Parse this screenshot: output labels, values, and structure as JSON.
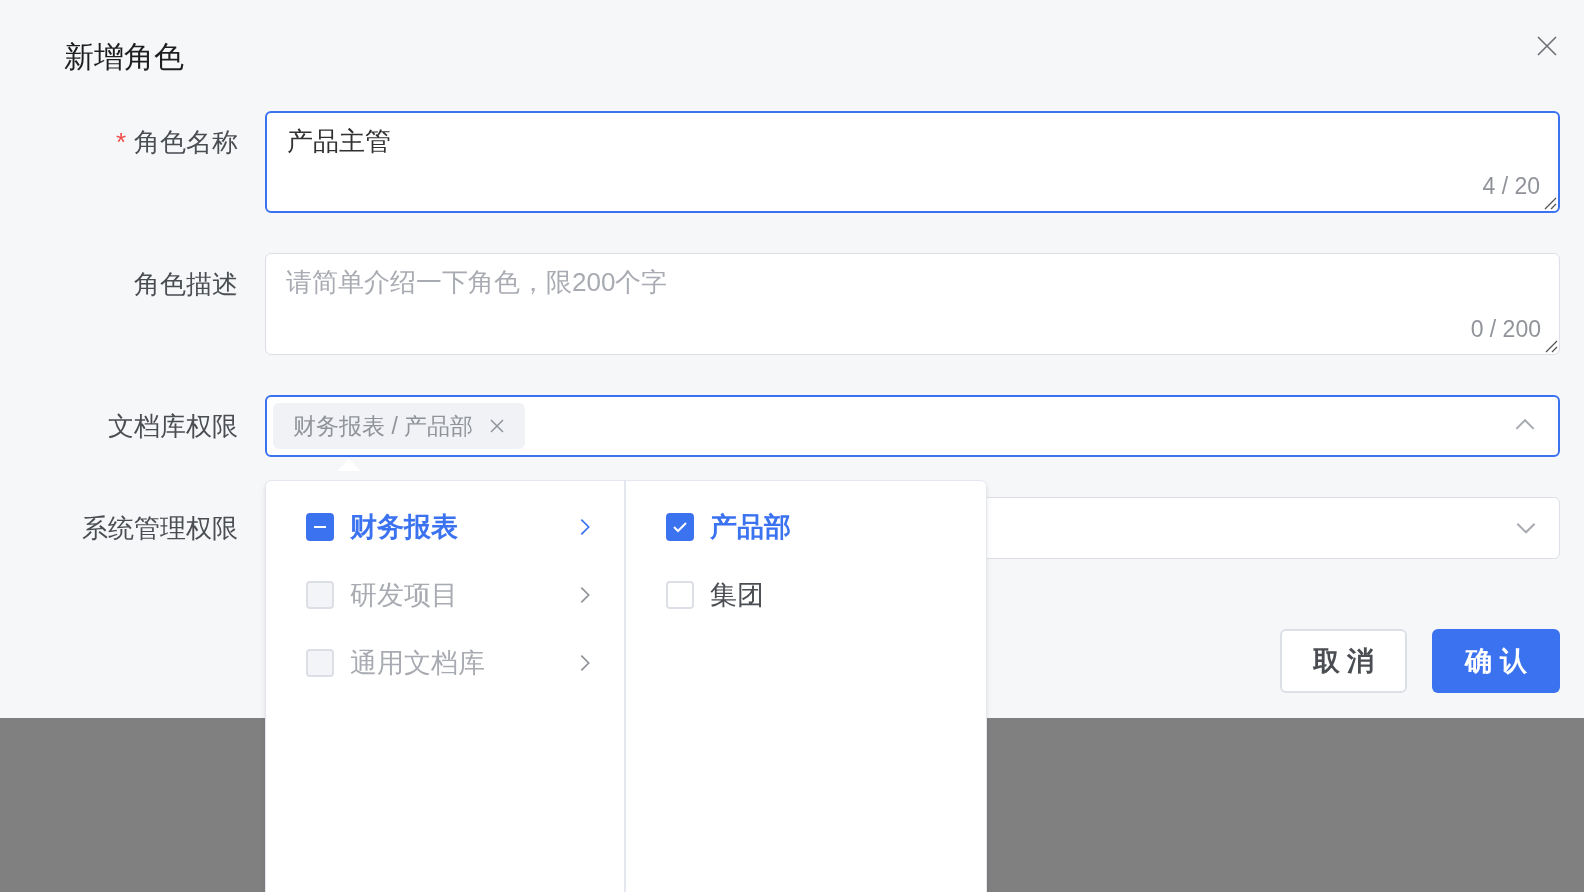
{
  "dialog": {
    "title": "新增角色",
    "fields": [
      {
        "kind": "textarea",
        "label": "角色名称",
        "required_mark": "*",
        "value": "产品主管",
        "counter": "4 / 20",
        "focused": true
      },
      {
        "kind": "textarea",
        "label": "角色描述",
        "placeholder": "请简单介绍一下角色，限200个字",
        "counter": "0 / 200",
        "focused": false
      },
      {
        "kind": "select",
        "label": "文档库权限",
        "tags": [
          "财务报表 / 产品部"
        ],
        "expanded": true,
        "focused": true
      },
      {
        "kind": "select",
        "label": "系统管理权限",
        "expanded": false,
        "focused": false
      }
    ],
    "buttons": [
      {
        "kind": "default",
        "label": "取 消"
      },
      {
        "kind": "primary",
        "label": "确 认"
      }
    ]
  },
  "cascader": {
    "columns": [
      [
        {
          "label": "财务报表",
          "checked": false,
          "indeterminate": true,
          "disabled": false,
          "selected": true,
          "has_children": true
        },
        {
          "label": "研发项目",
          "checked": false,
          "indeterminate": false,
          "disabled": true,
          "selected": false,
          "has_children": true
        },
        {
          "label": "通用文档库",
          "checked": false,
          "indeterminate": false,
          "disabled": true,
          "selected": false,
          "has_children": true
        }
      ],
      [
        {
          "label": "产品部",
          "checked": true,
          "indeterminate": false,
          "disabled": false,
          "selected": true,
          "has_children": false
        },
        {
          "label": "集团",
          "checked": false,
          "indeterminate": false,
          "disabled": false,
          "selected": false,
          "has_children": false
        }
      ]
    ]
  }
}
